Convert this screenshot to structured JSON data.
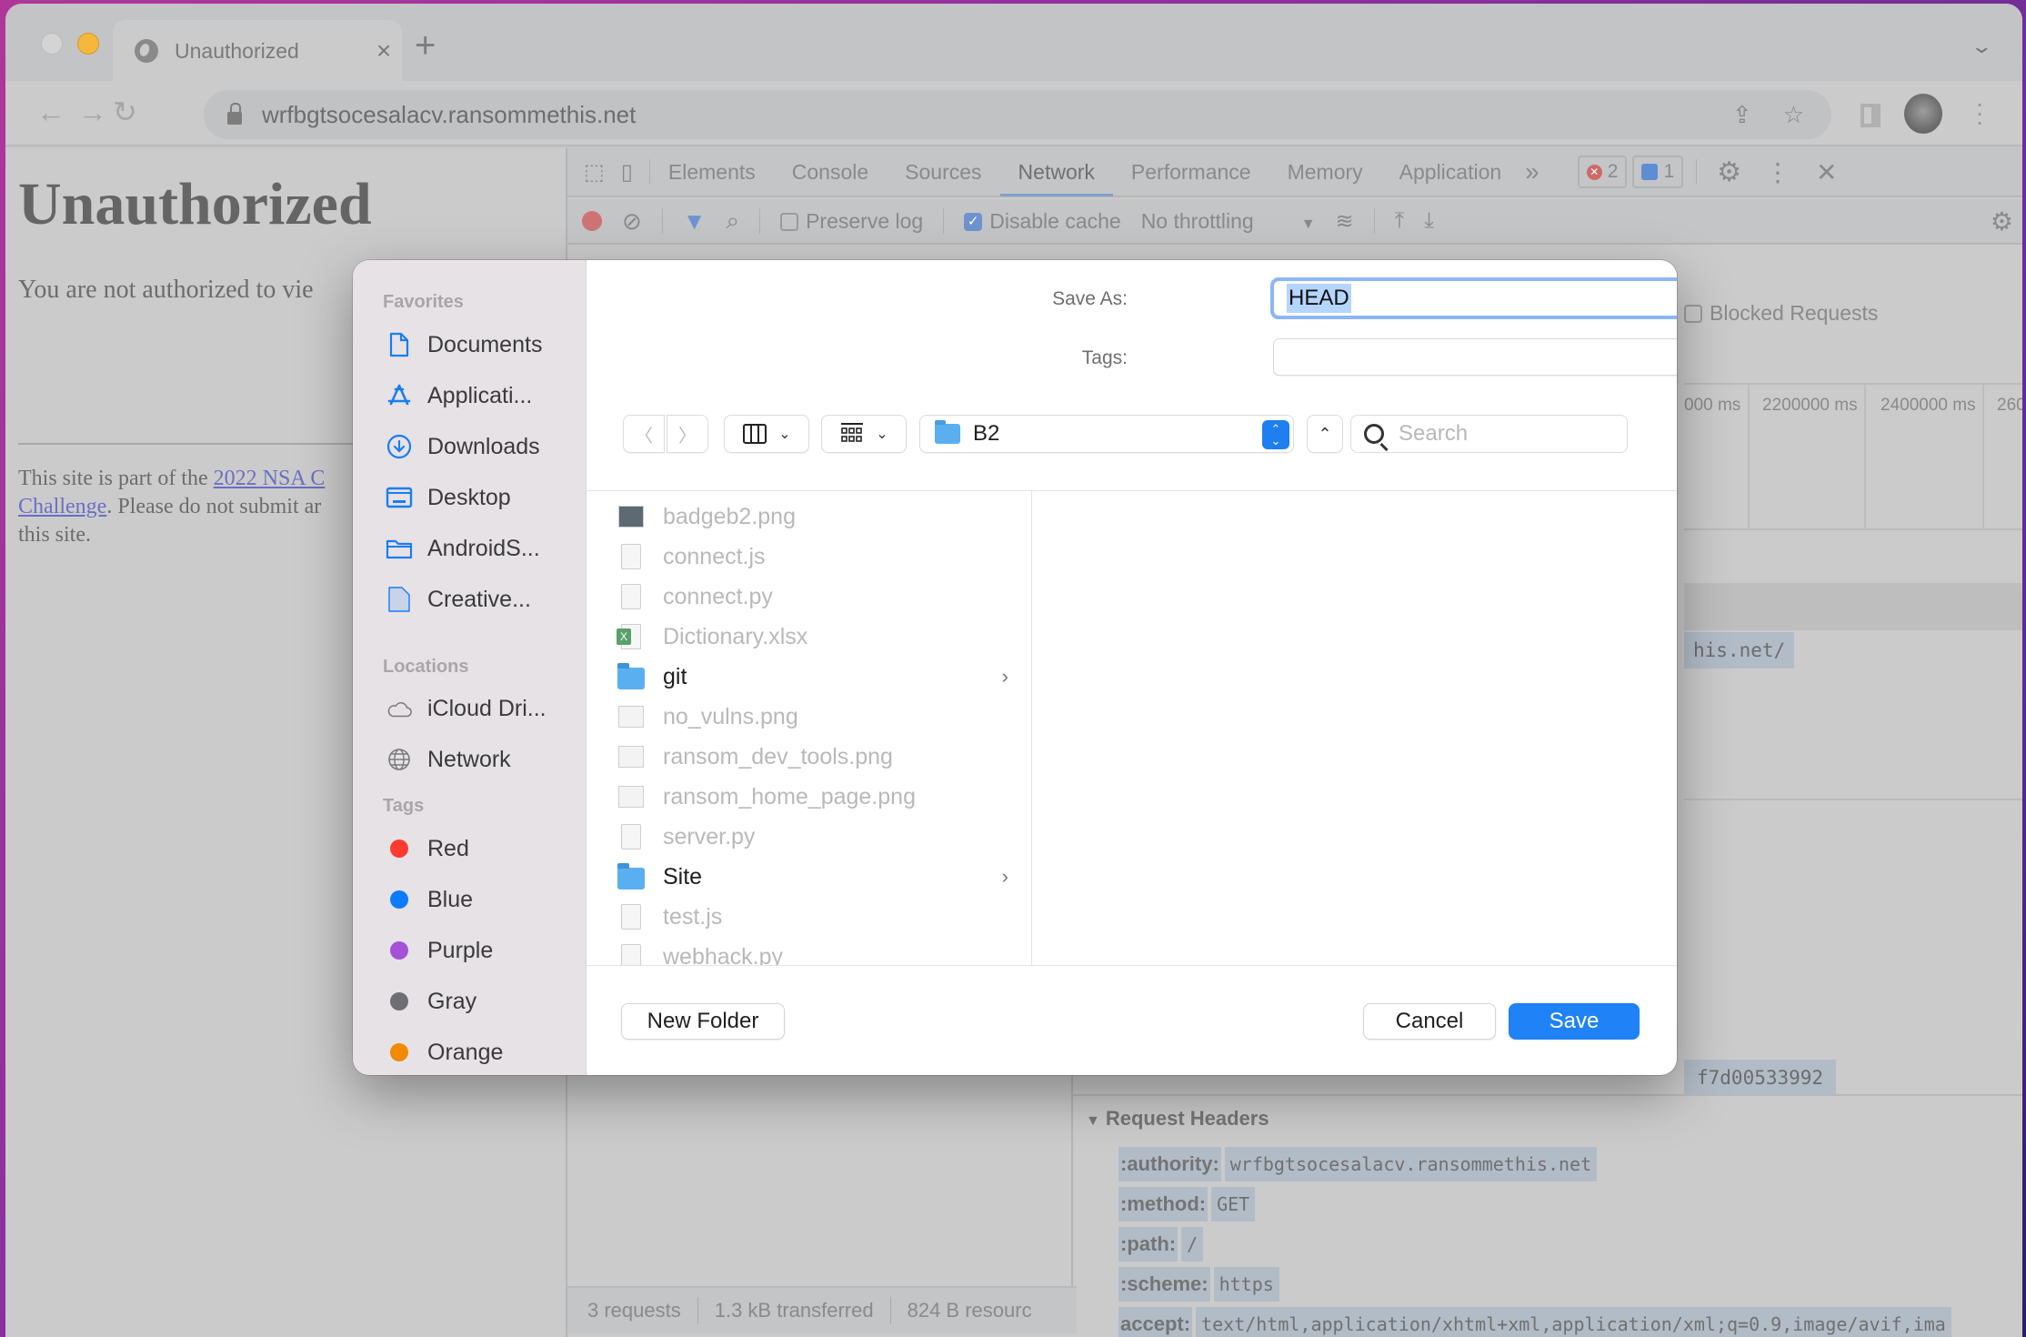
{
  "browser": {
    "tab_title": "Unauthorized",
    "tab_close": "×",
    "new_tab": "+",
    "tab_search": "⌄",
    "url": "wrfbgtsocesalacv.ransommethis.net",
    "back": "←",
    "forward": "→",
    "reload": "↻",
    "share": "⇪",
    "bookmark": "☆",
    "menu": "⋮"
  },
  "page": {
    "heading": "Unauthorized",
    "lead": "You are not authorized to vie",
    "footer_prefix": "This site is part of the ",
    "footer_link1": "2022 NSA C",
    "footer_link2": "Challenge",
    "footer_mid": ". Please do not submit ar",
    "footer_end": "this site."
  },
  "devtools": {
    "tabs": [
      "Elements",
      "Console",
      "Sources",
      "Network",
      "Performance",
      "Memory",
      "Application"
    ],
    "active_tab": "Network",
    "more": "»",
    "error_count": "2",
    "message_count": "1",
    "toolbar": {
      "preserve_log": "Preserve log",
      "preserve_log_checked": false,
      "disable_cache": "Disable cache",
      "disable_cache_checked": true,
      "throttling": "No throttling"
    },
    "blocked_requests": "Blocked Requests",
    "timeline_ticks": [
      "000 ms",
      "2200000 ms",
      "2400000 ms",
      "260"
    ],
    "url_fragment": "his.net/",
    "hash_fragment": "f7d00533992",
    "summary": {
      "requests": "3 requests",
      "transferred": "1.3 kB transferred",
      "resources": "824 B resourc"
    },
    "request_headers": {
      "title": "Request Headers",
      "rows": [
        {
          "key": ":authority:",
          "value": "wrfbgtsocesalacv.ransommethis.net"
        },
        {
          "key": ":method:",
          "value": "GET"
        },
        {
          "key": ":path:",
          "value": "/"
        },
        {
          "key": ":scheme:",
          "value": "https"
        },
        {
          "key": "accept:",
          "value": "text/html,application/xhtml+xml,application/xml;q=0.9,image/avif,ima"
        }
      ]
    }
  },
  "save_dialog": {
    "save_as_label": "Save As:",
    "save_as_value": "HEAD",
    "tags_label": "Tags:",
    "tags_value": "",
    "current_folder": "B2",
    "search_placeholder": "Search",
    "sidebar": {
      "favorites_header": "Favorites",
      "favorites": [
        {
          "label": "Documents",
          "icon": "document-icon"
        },
        {
          "label": "Applicati...",
          "icon": "applications-icon"
        },
        {
          "label": "Downloads",
          "icon": "downloads-icon"
        },
        {
          "label": "Desktop",
          "icon": "desktop-icon"
        },
        {
          "label": "AndroidS...",
          "icon": "folder-icon"
        },
        {
          "label": "Creative...",
          "icon": "document-filled-icon"
        }
      ],
      "locations_header": "Locations",
      "locations": [
        {
          "label": "iCloud Dri...",
          "icon": "cloud-icon"
        },
        {
          "label": "Network",
          "icon": "globe-icon"
        }
      ],
      "tags_header": "Tags",
      "tags": [
        {
          "label": "Red",
          "color": "#ff3b30"
        },
        {
          "label": "Blue",
          "color": "#0a7aff"
        },
        {
          "label": "Purple",
          "color": "#a550d6"
        },
        {
          "label": "Gray",
          "color": "#6e6e73"
        },
        {
          "label": "Orange",
          "color": "#f08a00"
        }
      ]
    },
    "files": [
      {
        "name": "badgeb2.png",
        "type": "image-dark",
        "enabled": false
      },
      {
        "name": "connect.js",
        "type": "doc",
        "enabled": false
      },
      {
        "name": "connect.py",
        "type": "doc",
        "enabled": false
      },
      {
        "name": "Dictionary.xlsx",
        "type": "xlsx",
        "enabled": false
      },
      {
        "name": "git",
        "type": "folder",
        "enabled": true
      },
      {
        "name": "no_vulns.png",
        "type": "image",
        "enabled": false
      },
      {
        "name": "ransom_dev_tools.png",
        "type": "image",
        "enabled": false
      },
      {
        "name": "ransom_home_page.png",
        "type": "image",
        "enabled": false
      },
      {
        "name": "server.py",
        "type": "doc",
        "enabled": false
      },
      {
        "name": "Site",
        "type": "folder",
        "enabled": true
      },
      {
        "name": "test.js",
        "type": "doc",
        "enabled": false
      },
      {
        "name": "webhack.py",
        "type": "doc",
        "enabled": false
      }
    ],
    "buttons": {
      "new_folder": "New Folder",
      "cancel": "Cancel",
      "save": "Save"
    }
  }
}
